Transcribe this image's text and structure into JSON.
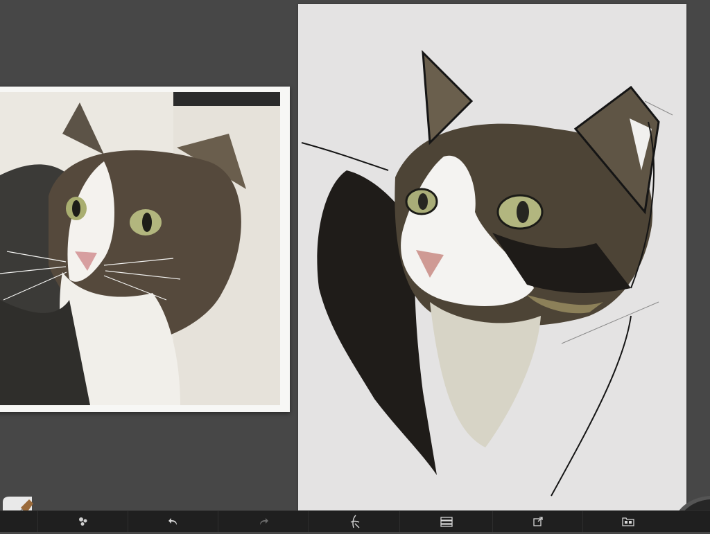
{
  "app": {
    "toolbar": {
      "items": [
        {
          "name": "brush-settings",
          "icon": "gear-cluster-icon"
        },
        {
          "name": "undo",
          "icon": "undo-arrow-icon"
        },
        {
          "name": "redo",
          "icon": "redo-arrow-icon"
        },
        {
          "name": "brush-library",
          "icon": "signature-brush-icon"
        },
        {
          "name": "layers",
          "icon": "layers-icon"
        },
        {
          "name": "share",
          "icon": "export-icon"
        },
        {
          "name": "gallery",
          "icon": "gallery-icon"
        }
      ],
      "redo_enabled": false
    },
    "current_tool": {
      "icon": "paintbrush-icon"
    },
    "color_swatch": {
      "icon": "color-puck-icon",
      "color": "#262626"
    }
  },
  "colors": {
    "workspace_bg": "#474747",
    "toolbar_bg": "#1f1f1f",
    "canvas_bg": "#e4e3e3"
  }
}
